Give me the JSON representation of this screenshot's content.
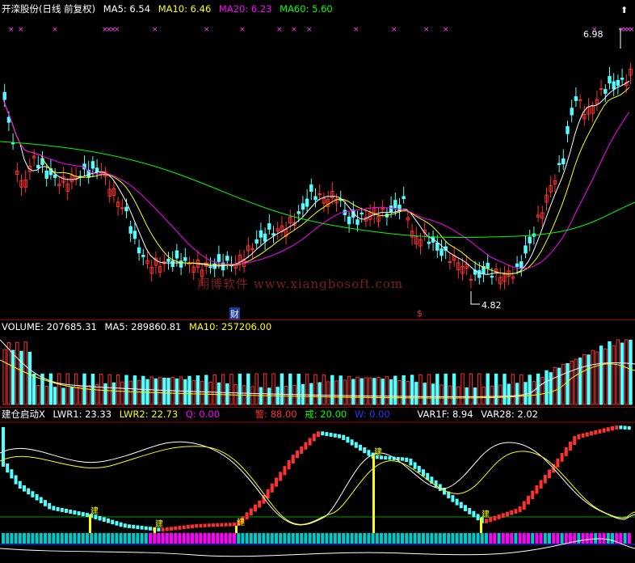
{
  "main_legend": {
    "title": "开滦股份(日线 前复权)",
    "items": [
      {
        "label": "MA5: 6.54",
        "color": "#ffffff"
      },
      {
        "label": "MA10: 6.46",
        "color": "#ffff00"
      },
      {
        "label": "MA20: 6.23",
        "color": "#ff00ff"
      },
      {
        "label": "MA60: 5.60",
        "color": "#00ff00"
      }
    ]
  },
  "price_high_label": "6.98",
  "price_low_label": "4.82",
  "event_marker_cai": "财",
  "event_marker_s": "$",
  "watermark": "翔博软件 www.xiangbosoft.com",
  "volume_legend": {
    "items": [
      {
        "label": "VOLUME: 207685.31",
        "color": "#ffffff"
      },
      {
        "label": "MA5: 289860.81",
        "color": "#ffffff"
      },
      {
        "label": "MA10: 257206.00",
        "color": "#ffff00"
      }
    ]
  },
  "indicator_legend": {
    "items": [
      {
        "label": "建仓启动X",
        "color": "#ffffff"
      },
      {
        "label": "LWR1: 23.33",
        "color": "#ffffff"
      },
      {
        "label": "LWR2: 22.73",
        "color": "#ffff00"
      },
      {
        "label": "Q: 0.00",
        "color": "#ff00ff"
      },
      {
        "label": "警: 88.00",
        "color": "#ff3030"
      },
      {
        "label": "戒: 20.00",
        "color": "#00ff00"
      },
      {
        "label": "W: 0.00",
        "color": "#3030ff"
      },
      {
        "label": "VAR1F: 8.94",
        "color": "#ffffff"
      },
      {
        "label": "VAR28: 2.02",
        "color": "#ffffff"
      }
    ]
  },
  "jian_marker": "建",
  "colors": {
    "up": "#ff3030",
    "down": "#54ffff",
    "ma5": "#ffffff",
    "ma10": "#ffff00",
    "ma20": "#ff00ff",
    "ma60": "#00ff00"
  }
}
